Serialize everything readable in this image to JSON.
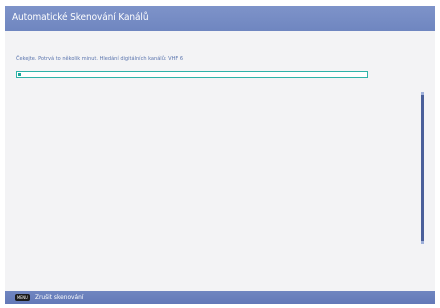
{
  "header": {
    "title": "Automatické Skenování Kanálů"
  },
  "scan": {
    "status_text": "Čekejte. Potrvá to několik minut. Hledání digitálních kanálů: VHF 6",
    "progress": 0.01
  },
  "footer": {
    "menu_key": "MENU",
    "cancel_label": "Zrušit skenování"
  },
  "colors": {
    "title_bar": "#7590c8",
    "status_text": "#5b75ae",
    "progress_border": "#2fb3a8",
    "progress_fill": "#1aa79a",
    "scrollbar": "#4a5f9a"
  }
}
